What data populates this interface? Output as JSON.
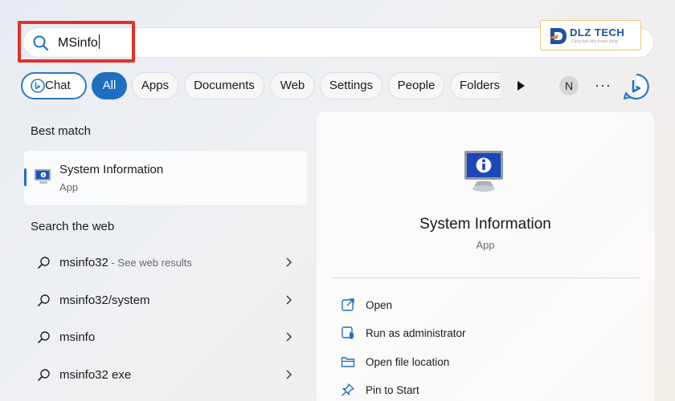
{
  "search": {
    "value": "MSinfo"
  },
  "logo": {
    "text": "DLZ TECH",
    "tagline": "Cùng bạn đến thành công"
  },
  "filters": [
    {
      "label": "Chat"
    },
    {
      "label": "All",
      "selected": true
    },
    {
      "label": "Apps"
    },
    {
      "label": "Documents"
    },
    {
      "label": "Web"
    },
    {
      "label": "Settings"
    },
    {
      "label": "People"
    },
    {
      "label": "Folders"
    }
  ],
  "account": {
    "initial": "N"
  },
  "more_label": "···",
  "best_match": {
    "heading": "Best match",
    "name": "System Information",
    "type": "App"
  },
  "web_search": {
    "heading": "Search the web",
    "items": [
      {
        "label": "msinfo32",
        "hint": " - See web results"
      },
      {
        "label": "msinfo32/system",
        "hint": ""
      },
      {
        "label": "msinfo",
        "hint": ""
      },
      {
        "label": "msinfo32 exe",
        "hint": ""
      }
    ]
  },
  "detail": {
    "name": "System Information",
    "type": "App",
    "actions": [
      {
        "label": "Open",
        "icon": "open-icon"
      },
      {
        "label": "Run as administrator",
        "icon": "shield-icon"
      },
      {
        "label": "Open file location",
        "icon": "folder-icon"
      },
      {
        "label": "Pin to Start",
        "icon": "pin-icon"
      }
    ]
  },
  "colors": {
    "accent": "#1e6fc0",
    "highlight": "#e3302a"
  }
}
